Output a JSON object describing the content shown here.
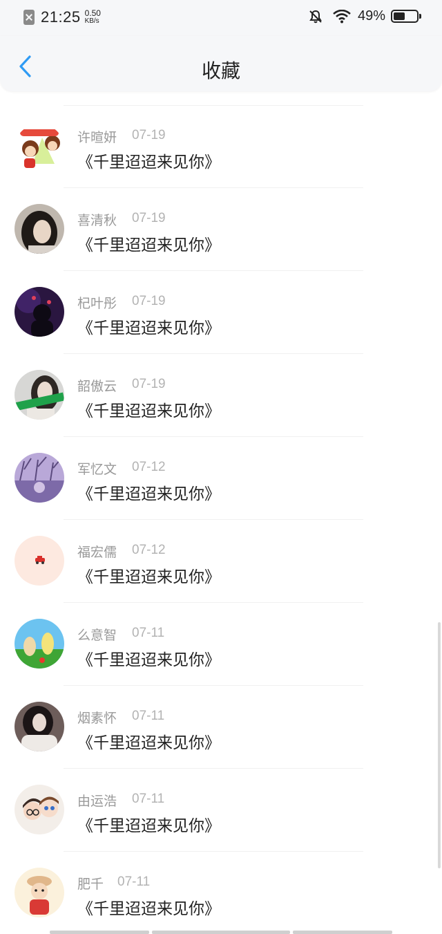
{
  "status": {
    "time": "21:25",
    "net_speed_value": "0.50",
    "net_speed_unit": "KB/s",
    "battery_percent_text": "49%",
    "battery_level": 0.49,
    "icons": [
      "sim-off-icon",
      "bell-muted-icon",
      "wifi-icon",
      "battery-icon"
    ]
  },
  "header": {
    "title": "收藏",
    "back_icon": "chevron-left-icon",
    "accent": "#2f9bf4"
  },
  "items": [
    {
      "name": "许暄妍",
      "date": "07-19",
      "title": "《千里迢迢来见你》"
    },
    {
      "name": "喜清秋",
      "date": "07-19",
      "title": "《千里迢迢来见你》"
    },
    {
      "name": "杞叶彤",
      "date": "07-19",
      "title": "《千里迢迢来见你》"
    },
    {
      "name": "韶傲云",
      "date": "07-19",
      "title": "《千里迢迢来见你》"
    },
    {
      "name": "军忆文",
      "date": "07-12",
      "title": "《千里迢迢来见你》"
    },
    {
      "name": "福宏儒",
      "date": "07-12",
      "title": "《千里迢迢来见你》"
    },
    {
      "name": "么意智",
      "date": "07-11",
      "title": "《千里迢迢来见你》"
    },
    {
      "name": "烟素怀",
      "date": "07-11",
      "title": "《千里迢迢来见你》"
    },
    {
      "name": "由运浩",
      "date": "07-11",
      "title": "《千里迢迢来见你》"
    },
    {
      "name": "肥千",
      "date": "07-11",
      "title": "《千里迢迢来见你》"
    }
  ]
}
